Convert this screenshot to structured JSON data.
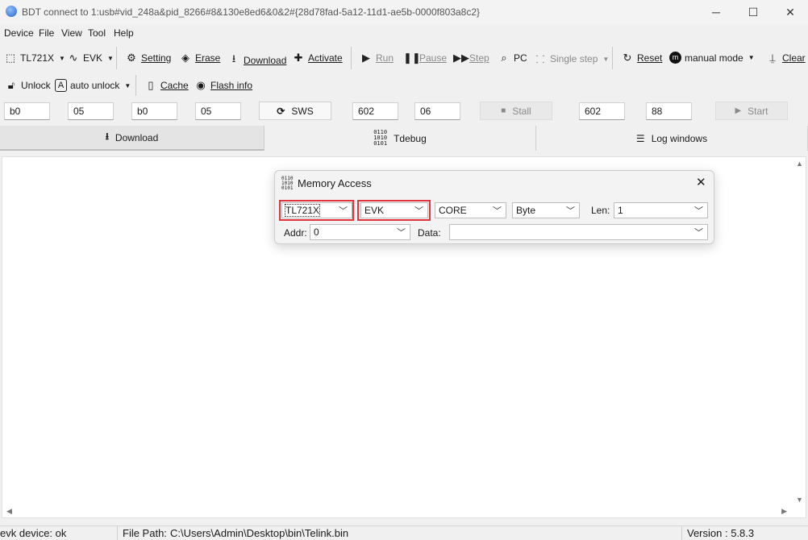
{
  "window": {
    "title": "BDT connect to 1:usb#vid_248a&pid_8266#8&130e8ed6&0&2#{28d78fad-5a12-11d1-ae5b-0000f803a8c2}"
  },
  "menu": [
    "Device",
    "File",
    "View",
    "Tool",
    "Help"
  ],
  "toolbar1": {
    "chip": "TL721X",
    "board": "EVK",
    "setting": "Setting",
    "erase": "Erase",
    "download": "Download",
    "activate": "Activate",
    "run": "Run",
    "pause": "Pause",
    "step": "Step",
    "pc": "PC",
    "single_step": "Single step",
    "reset": "Reset",
    "mode": "manual mode",
    "clear": "Clear"
  },
  "toolbar2": {
    "unlock": "Unlock",
    "auto_unlock": "auto unlock",
    "cache": "Cache",
    "flash_info": "Flash info"
  },
  "fields": {
    "f1": "b0",
    "f2": "05",
    "f3": "b0",
    "f4": "05",
    "sws": "SWS",
    "f5": "602",
    "f6": "06",
    "stall": "Stall",
    "f7": "602",
    "f8": "88",
    "start": "Start"
  },
  "tabs": [
    "Download",
    "Tdebug",
    "Log windows"
  ],
  "dialog": {
    "title": "Memory Access",
    "chip": "TL721X",
    "board": "EVK",
    "target": "CORE",
    "width": "Byte",
    "len_label": "Len:",
    "len": "1",
    "addr_label": "Addr:",
    "addr": "0",
    "data_label": "Data:",
    "data": ""
  },
  "status": {
    "device": "evk device: ok",
    "path_label": "File Path:",
    "path": "C:\\Users\\Admin\\Desktop\\bin\\Telink.bin",
    "version": "Version : 5.8.3"
  },
  "colors": {
    "highlight": "#e1343f"
  }
}
